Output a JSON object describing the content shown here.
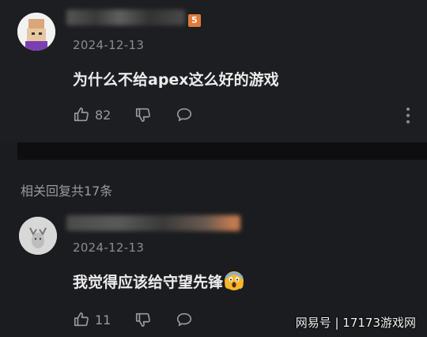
{
  "comments": [
    {
      "badge": "5",
      "date": "2024-12-13",
      "text": "为什么不给apex这么好的游戏",
      "like_count": "82"
    },
    {
      "date": "2024-12-13",
      "text": "我觉得应该给守望先锋",
      "like_count": "11",
      "emoji": "face-screaming-in-fear"
    }
  ],
  "related_replies_label": "相关回复共17条",
  "watermark": "网易号 | 17173游戏网",
  "colors": {
    "background": "#1b1c1f",
    "badge": "#e07b3c",
    "text": "#ececec",
    "secondary_text": "#8c8c8c"
  }
}
